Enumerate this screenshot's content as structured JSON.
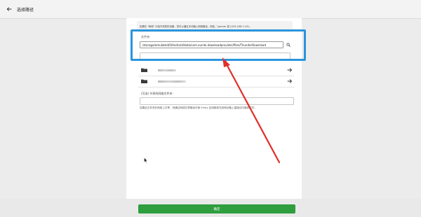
{
  "header": {
    "title": "选择路径",
    "back_icon": "back-arrow-icon"
  },
  "hint_top": "如果在 \"网络\" 中找不到您的设备，您可以通过手动输入网络路径。例如，\\\\server 或 \\\\192.168.1.101。",
  "folder_field": {
    "label": "文件夹:",
    "value": "/storage/emulated/0/Android/data/com.xunlei.downloadprovider/files/ThunderDownload",
    "search_icon": "search-icon"
  },
  "directories": [
    {
      "name_redacted": true,
      "icon": "folder-icon",
      "arrow": "arrow-right-icon"
    },
    {
      "name_redacted": true,
      "icon": "folder-icon",
      "arrow": "arrow-right-icon"
    }
  ],
  "share": {
    "label": "(可选) 共享的网络文件夹:",
    "value": "",
    "hint": "如果此文件夹在网络上共享，则通过网络共享路径可使 Emby 应用程序在其他设备上直接访问媒体文件。"
  },
  "confirm_label": "确定",
  "colors": {
    "accent_green": "#2f9e3f",
    "highlight_blue": "#2a95dc",
    "annotation_red": "#e0302a"
  }
}
